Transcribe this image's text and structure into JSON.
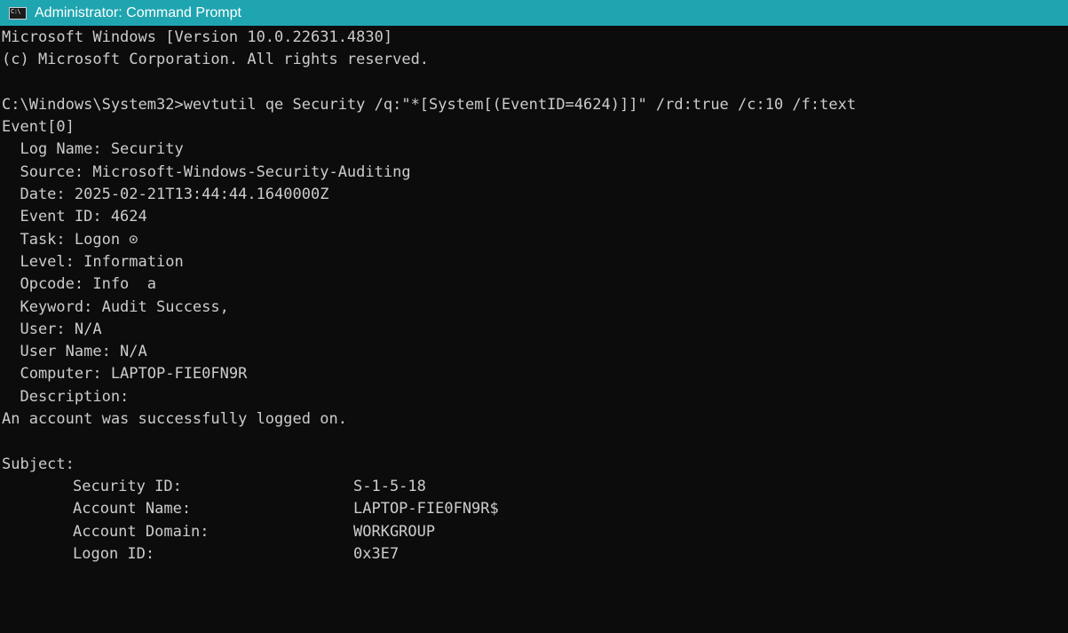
{
  "window": {
    "title": "Administrator: Command Prompt",
    "icon_glyph": "C:\\",
    "icon": "command-prompt-icon"
  },
  "console": {
    "header_line1": "Microsoft Windows [Version 10.0.22631.4830]",
    "header_line2": "(c) Microsoft Corporation. All rights reserved.",
    "command_line": "C:\\Windows\\System32>wevtutil qe Security /q:\"*[System[(EventID=4624)]]\" /rd:true /c:10 /f:text",
    "event_header": "Event[0]",
    "fields": [
      "  Log Name: Security",
      "  Source: Microsoft-Windows-Security-Auditing",
      "  Date: 2025-02-21T13:44:44.1640000Z",
      "  Event ID: 4624",
      "  Task: Logon ⊙",
      "  Level: Information",
      "  Opcode: Info  a",
      "  Keyword: Audit Success,",
      "  User: N/A",
      "  User Name: N/A",
      "  Computer: LAPTOP-FIE0FN9R",
      "  Description:"
    ],
    "description_text": "An account was successfully logged on.",
    "subject_header": "Subject:",
    "subject": [
      {
        "label": "Security ID:",
        "value": "S-1-5-18"
      },
      {
        "label": "Account Name:",
        "value": "LAPTOP-FIE0FN9R$"
      },
      {
        "label": "Account Domain:",
        "value": "WORKGROUP"
      },
      {
        "label": "Logon ID:",
        "value": "0x3E7"
      }
    ]
  },
  "colors": {
    "titlebar": "#1fa5b0",
    "console_bg": "#0c0c0c",
    "console_text": "#cccccc"
  }
}
